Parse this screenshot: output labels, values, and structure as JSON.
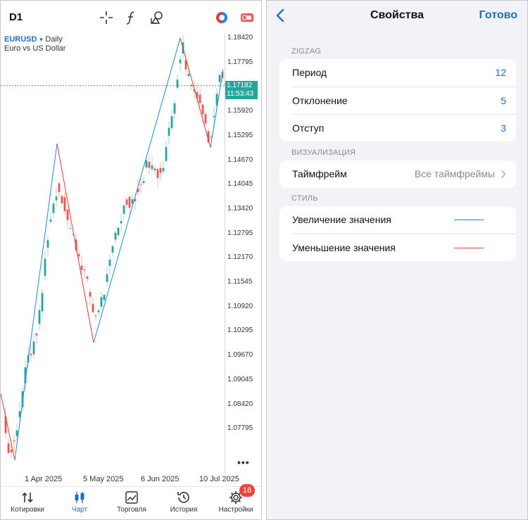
{
  "chart": {
    "timeframe": "D1",
    "symbol": "EURUSD",
    "period": "Daily",
    "description": "Euro vs US Dollar",
    "current_price": "1.17182",
    "countdown": "11:53:43",
    "price_labels": [
      "1.18420",
      "1.17795",
      "1.16545",
      "1.15920",
      "1.15295",
      "1.14670",
      "1.14045",
      "1.13420",
      "1.12795",
      "1.12170",
      "1.11545",
      "1.10920",
      "1.10295",
      "1.09670",
      "1.09045",
      "1.08420",
      "1.07795"
    ],
    "date_labels": [
      "1 Apr 2025",
      "5 May 2025",
      "6 Jun 2025",
      "10 Jul 2025"
    ],
    "more": "•••",
    "colors": {
      "bull": "#26a69a",
      "bear": "#ef5350",
      "zigzag_up": "#1e88e5",
      "zigzag_down": "#e53935"
    }
  },
  "toolbar": {
    "icons": [
      "crosshair-icon",
      "function-icon",
      "objects-icon",
      "trade-toggle-icon",
      "one-click-trading-icon"
    ]
  },
  "tabs": [
    {
      "name": "quotes",
      "label": "Котировки",
      "icon": "arrows-updown-icon",
      "active": false
    },
    {
      "name": "chart",
      "label": "Чарт",
      "icon": "candles-icon",
      "active": true
    },
    {
      "name": "trade",
      "label": "Торговля",
      "icon": "trade-chart-icon",
      "active": false
    },
    {
      "name": "history",
      "label": "История",
      "icon": "history-icon",
      "active": false
    },
    {
      "name": "settings",
      "label": "Настройки",
      "icon": "gear-icon",
      "active": false
    }
  ],
  "settings_badge": "18",
  "properties": {
    "title": "Свойства",
    "done_label": "Готово",
    "sections": {
      "zigzag": {
        "title": "ZIGZAG",
        "rows": [
          {
            "label": "Период",
            "value": "12"
          },
          {
            "label": "Отклонение",
            "value": "5"
          },
          {
            "label": "Отступ",
            "value": "3"
          }
        ]
      },
      "visualization": {
        "title": "ВИЗУАЛИЗАЦИЯ",
        "rows": [
          {
            "label": "Таймфрейм",
            "value": "Все таймфреймы"
          }
        ]
      },
      "style": {
        "title": "СТИЛЬ",
        "rows": [
          {
            "label": "Увеличение значения",
            "color": "#1e88e5"
          },
          {
            "label": "Уменьшение значения",
            "color": "#e53935"
          }
        ]
      }
    }
  }
}
